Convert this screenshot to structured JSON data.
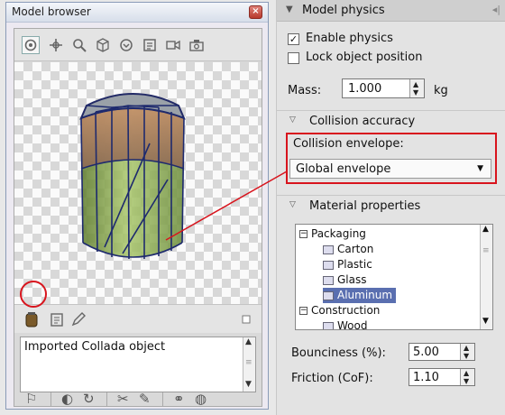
{
  "model_browser": {
    "title": "Model browser",
    "description": "Imported Collada object",
    "toolbar_icons": [
      "rotate-icon",
      "move-icon",
      "zoom-icon",
      "cube-icon",
      "target-icon",
      "frame-icon",
      "camera-icon",
      "snapshot-icon"
    ],
    "bottom_icons": [
      "jar-icon",
      "edit-icon",
      "small-square-icon"
    ],
    "footer_icons": [
      "flag-icon",
      "half-circle-icon",
      "sync-icon",
      "tools-icon",
      "pencil-icon",
      "link-icon",
      "globe-icon"
    ]
  },
  "model_physics": {
    "title": "Model physics",
    "enable_physics": {
      "label": "Enable physics",
      "checked": true
    },
    "lock_position": {
      "label": "Lock object position",
      "checked": false
    },
    "mass": {
      "label": "Mass:",
      "value": "1.000",
      "unit": "kg"
    },
    "collision_section": "Collision accuracy",
    "collision_envelope": {
      "label": "Collision envelope:",
      "value": "Global envelope"
    },
    "material_section": "Material properties",
    "materials": {
      "packaging": "Packaging",
      "carton": "Carton",
      "plastic": "Plastic",
      "glass": "Glass",
      "aluminum": "Aluminum",
      "construction": "Construction",
      "wood": "Wood"
    },
    "bounciness": {
      "label": "Bounciness (%):",
      "value": "5.00"
    },
    "friction": {
      "label": "Friction (CoF):",
      "value": "1.10"
    }
  },
  "colors": {
    "callout": "#d8141d",
    "selection": "#5a6fb0"
  }
}
